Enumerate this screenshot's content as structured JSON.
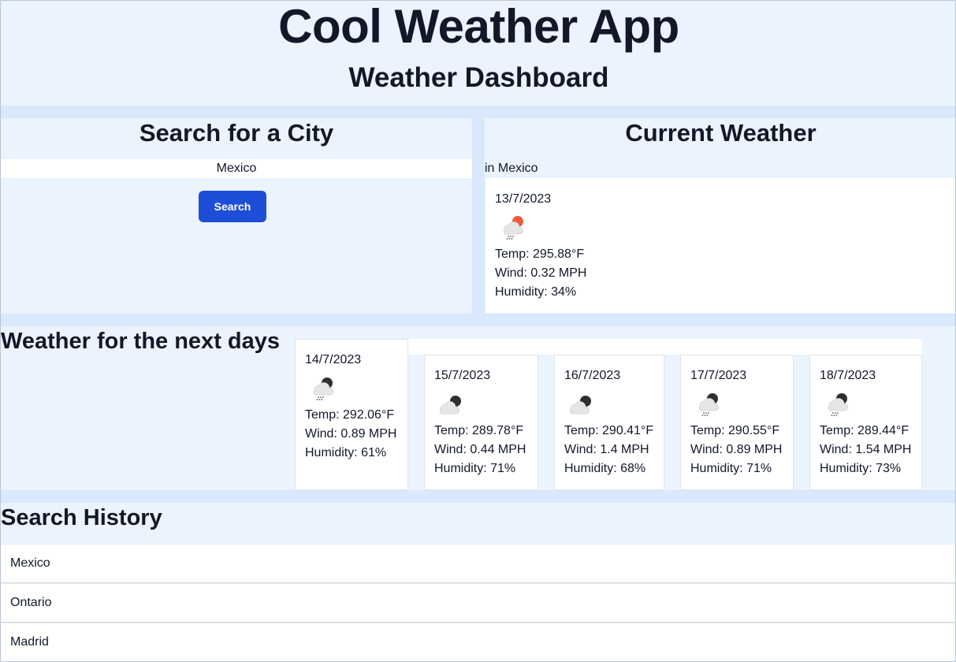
{
  "header": {
    "app_title": "Cool Weather App",
    "subtitle": "Weather Dashboard"
  },
  "search": {
    "title": "Search for a City",
    "input_value": "Mexico",
    "button_label": "Search"
  },
  "current": {
    "title": "Current Weather",
    "city_line": "in Mexico",
    "date": "13/7/2023",
    "icon": "rain-sun-icon",
    "temp": "Temp: 295.88°F",
    "wind": "Wind: 0.32 MPH",
    "humidity": "Humidity: 34%"
  },
  "forecast": {
    "title": "Weather for the next days",
    "days": [
      {
        "date": "14/7/2023",
        "icon": "rain-night-icon",
        "temp": "Temp: 292.06°F",
        "wind": "Wind: 0.89 MPH",
        "humidity": "Humidity: 61%"
      },
      {
        "date": "15/7/2023",
        "icon": "cloudy-night-icon",
        "temp": "Temp: 289.78°F",
        "wind": "Wind: 0.44 MPH",
        "humidity": "Humidity: 71%"
      },
      {
        "date": "16/7/2023",
        "icon": "cloudy-night-icon",
        "temp": "Temp: 290.41°F",
        "wind": "Wind: 1.4 MPH",
        "humidity": "Humidity: 68%"
      },
      {
        "date": "17/7/2023",
        "icon": "rain-night-icon",
        "temp": "Temp: 290.55°F",
        "wind": "Wind: 0.89 MPH",
        "humidity": "Humidity: 71%"
      },
      {
        "date": "18/7/2023",
        "icon": "rain-night-icon",
        "temp": "Temp: 289.44°F",
        "wind": "Wind: 1.54 MPH",
        "humidity": "Humidity: 73%"
      }
    ]
  },
  "history": {
    "title": "Search History",
    "items": [
      "Mexico",
      "Ontario",
      "Madrid"
    ]
  },
  "colors": {
    "panel_bg": "#ebf3fe",
    "gutter_bg": "#d9e8fc",
    "button_bg": "#1d4ed8",
    "sun_red": "#ef5a3c"
  }
}
